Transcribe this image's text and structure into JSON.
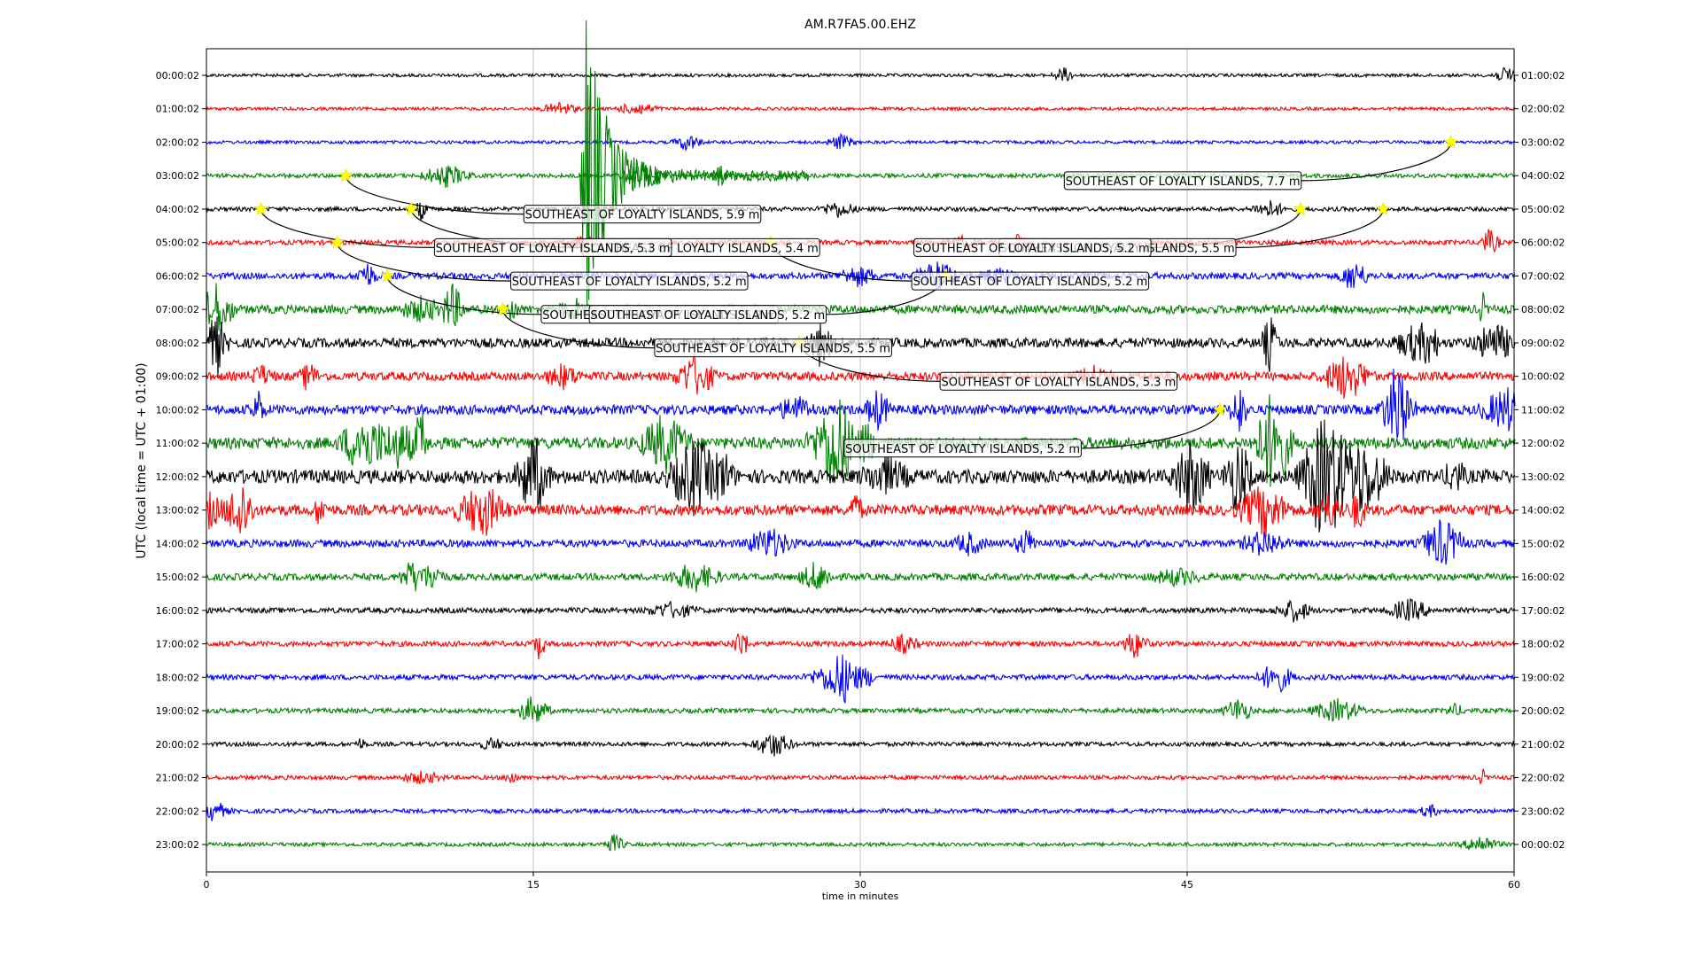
{
  "chart_data": {
    "type": "line",
    "title": "AM.R7FA5.00.EHZ",
    "xlabel": "time in minutes",
    "ylabel": "UTC (local time = UTC + 01:00)",
    "xlim": [
      0,
      60
    ],
    "x_ticks": [
      0,
      15,
      30,
      45,
      60
    ],
    "grid": "vertical at x ticks",
    "trace_colors": [
      "#000000",
      "#ff0000",
      "#0000ff",
      "#008000"
    ],
    "rows": [
      {
        "left": "00:00:02",
        "right": "01:00:02",
        "amp": 0.6
      },
      {
        "left": "01:00:02",
        "right": "02:00:02",
        "amp": 0.6
      },
      {
        "left": "02:00:02",
        "right": "03:00:02",
        "amp": 0.6
      },
      {
        "left": "03:00:02",
        "right": "04:00:02",
        "amp": 0.8
      },
      {
        "left": "04:00:02",
        "right": "05:00:02",
        "amp": 0.8
      },
      {
        "left": "05:00:02",
        "right": "06:00:02",
        "amp": 0.9
      },
      {
        "left": "06:00:02",
        "right": "07:00:02",
        "amp": 1.2
      },
      {
        "left": "07:00:02",
        "right": "08:00:02",
        "amp": 1.6
      },
      {
        "left": "08:00:02",
        "right": "09:00:02",
        "amp": 1.8
      },
      {
        "left": "09:00:02",
        "right": "10:00:02",
        "amp": 1.6
      },
      {
        "left": "10:00:02",
        "right": "11:00:02",
        "amp": 1.8
      },
      {
        "left": "11:00:02",
        "right": "12:00:02",
        "amp": 2.2
      },
      {
        "left": "12:00:02",
        "right": "13:00:02",
        "amp": 2.6
      },
      {
        "left": "13:00:02",
        "right": "14:00:02",
        "amp": 2.0
      },
      {
        "left": "14:00:02",
        "right": "15:00:02",
        "amp": 1.4
      },
      {
        "left": "15:00:02",
        "right": "16:00:02",
        "amp": 1.3
      },
      {
        "left": "16:00:02",
        "right": "17:00:02",
        "amp": 1.0
      },
      {
        "left": "17:00:02",
        "right": "18:00:02",
        "amp": 1.0
      },
      {
        "left": "18:00:02",
        "right": "19:00:02",
        "amp": 1.0
      },
      {
        "left": "19:00:02",
        "right": "20:00:02",
        "amp": 0.9
      },
      {
        "left": "20:00:02",
        "right": "21:00:02",
        "amp": 0.8
      },
      {
        "left": "21:00:02",
        "right": "22:00:02",
        "amp": 0.8
      },
      {
        "left": "22:00:02",
        "right": "23:00:02",
        "amp": 0.8
      },
      {
        "left": "23:00:02",
        "right": "00:00:02",
        "amp": 0.7
      }
    ],
    "main_quake": {
      "row": 3,
      "start_minute": 17.1
    },
    "events": [
      {
        "text": "SOUTHEAST OF LOYALTY ISLANDS, 7.7 m",
        "row": 2,
        "minute": 57.1,
        "label_row": 3.15,
        "label_minute": 44.8
      },
      {
        "text": "SOUTHEAST OF LOYALTY ISLANDS, 5.9 m",
        "row": 3,
        "minute": 6.4,
        "label_row": 4.15,
        "label_minute": 20.0
      },
      {
        "text": "SOUTHEAST OF LOYALTY ISLANDS, 5.4 m",
        "row": 4,
        "minute": 9.4,
        "label_row": 5.15,
        "label_minute": 22.7
      },
      {
        "text": "SOUTHEAST OF LOYALTY ISLANDS, 5.5 m",
        "row": 4,
        "minute": 54.0,
        "label_row": 5.15,
        "label_minute": 41.8
      },
      {
        "text": "SOUTHEAST OF LOYALTY ISLANDS, 5.3 m",
        "row": 4,
        "minute": 2.5,
        "label_row": 5.15,
        "label_minute": 15.9
      },
      {
        "text": "SOUTHEAST OF LOYALTY ISLANDS, 5.2 m",
        "row": 4,
        "minute": 50.2,
        "label_row": 5.15,
        "label_minute": 37.9
      },
      {
        "text": "SOUTHEAST OF LOYALTY ISLANDS, 5.2 m",
        "row": 5,
        "minute": 6.0,
        "label_row": 6.15,
        "label_minute": 19.4
      },
      {
        "text": "SOUTHEAST OF LOYALTY ISLANDS, 5.2 m",
        "row": 5,
        "minute": 25.9,
        "label_row": 6.15,
        "label_minute": 37.8
      },
      {
        "text": "SOUTHEAST OF LOYALTY ISLANDS, 5.2 m",
        "row": 6,
        "minute": 8.3,
        "label_row": 7.15,
        "label_minute": 20.8
      },
      {
        "text": "SOUTHEAST OF LOYALTY ISLANDS, 5.2 m",
        "row": 6,
        "minute": 33.9,
        "label_row": 7.15,
        "label_minute": 23.0
      },
      {
        "text": "SOUTHEAST OF LOYALTY ISLANDS, 5.5 m",
        "row": 7,
        "minute": 13.6,
        "label_row": 8.15,
        "label_minute": 26.0
      },
      {
        "text": "SOUTHEAST OF LOYALTY ISLANDS, 5.3 m",
        "row": 8,
        "minute": 27.2,
        "label_row": 9.15,
        "label_minute": 39.1
      },
      {
        "text": "SOUTHEAST OF LOYALTY ISLANDS, 5.2 m",
        "row": 10,
        "minute": 46.5,
        "label_row": 11.15,
        "label_minute": 34.7
      }
    ]
  }
}
